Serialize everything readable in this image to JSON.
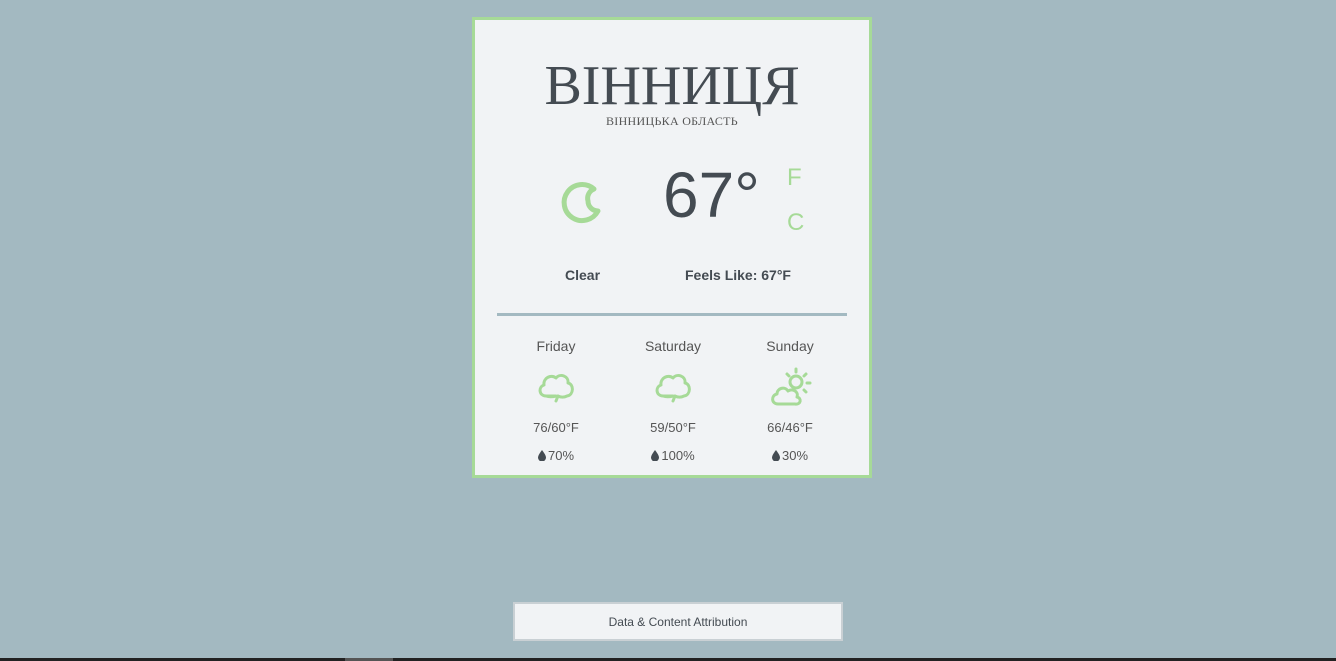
{
  "location": {
    "city": "ВІННИЦЯ",
    "region": "ВІННИЦЬКА ОБЛАСТЬ"
  },
  "current": {
    "icon": "moon-clear-icon",
    "temperature": "67°",
    "unit_f": "F",
    "unit_c": "C",
    "condition": "Clear",
    "feels_like": "Feels Like: 67°F"
  },
  "forecast": [
    {
      "day": "Friday",
      "icon": "cloud-icon",
      "temps": "76/60°F",
      "precip": "70%"
    },
    {
      "day": "Saturday",
      "icon": "cloud-icon",
      "temps": "59/50°F",
      "precip": "100%"
    },
    {
      "day": "Sunday",
      "icon": "partly-sunny-icon",
      "temps": "66/46°F",
      "precip": "30%"
    }
  ],
  "footer": {
    "attribution_label": "Data & Content Attribution"
  },
  "colors": {
    "background": "#a3b9c1",
    "card": "#f1f3f5",
    "accent": "#a6da97",
    "text": "#444b52"
  }
}
